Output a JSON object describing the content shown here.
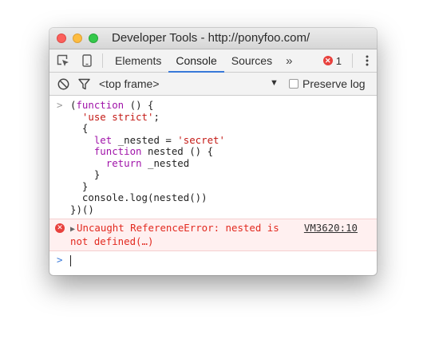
{
  "window": {
    "title": "Developer Tools - http://ponyfoo.com/"
  },
  "tabbar": {
    "icons": [
      "select-element-icon",
      "device-toggle-icon"
    ],
    "tabs": [
      {
        "label": "Elements",
        "active": false
      },
      {
        "label": "Console",
        "active": true
      },
      {
        "label": "Sources",
        "active": false
      }
    ],
    "more": "»",
    "error_count": "1",
    "menu_icon": "kebab-menu-icon"
  },
  "toolbar": {
    "frame": "<top frame>",
    "preserve_log": "Preserve log",
    "preserve_checked": false
  },
  "console": {
    "prompt": ">",
    "input_code": [
      [
        [
          "(",
          ""
        ],
        [
          "function",
          "kw"
        ],
        [
          " () {",
          ""
        ]
      ],
      [
        [
          "  ",
          ""
        ],
        [
          "'use strict'",
          "str"
        ],
        [
          ";",
          ""
        ]
      ],
      [
        [
          "  {",
          ""
        ]
      ],
      [
        [
          "    ",
          ""
        ],
        [
          "let",
          "kw"
        ],
        [
          " _nested = ",
          ""
        ],
        [
          "'secret'",
          "str"
        ]
      ],
      [
        [
          "    ",
          ""
        ],
        [
          "function",
          "kw"
        ],
        [
          " nested () {",
          ""
        ]
      ],
      [
        [
          "      ",
          ""
        ],
        [
          "return",
          "kw"
        ],
        [
          " _nested",
          ""
        ]
      ],
      [
        [
          "    }",
          ""
        ]
      ],
      [
        [
          "  }",
          ""
        ]
      ],
      [
        [
          "  console.log(nested())",
          ""
        ]
      ],
      [
        [
          "})()",
          ""
        ]
      ]
    ],
    "error": {
      "line1": "Uncaught ReferenceError: nested is",
      "line2": "not defined(…)",
      "source": "VM3620:10"
    },
    "input_prompt": ">"
  },
  "colors": {
    "keyword": "#a013a9",
    "string": "#c41a16",
    "error_text": "#e2291f",
    "error_bg": "#fff0f0",
    "active_tab": "#3879d9"
  }
}
